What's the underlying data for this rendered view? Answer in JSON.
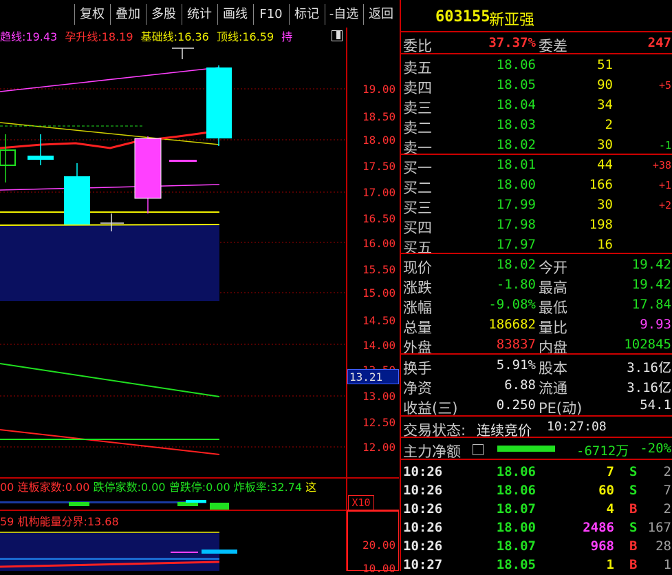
{
  "toolbar": {
    "buttons": [
      "复权",
      "叠加",
      "多股",
      "统计",
      "画线",
      "F10",
      "标记",
      "-自选",
      "返回"
    ]
  },
  "indicator_top": {
    "items": [
      {
        "label": "趋线:",
        "value": "19.43",
        "color": "#ff40ff"
      },
      {
        "label": "孕升线:",
        "value": "18.19",
        "color": "#ff3030"
      },
      {
        "label": "基础线:",
        "value": "16.36",
        "color": "#f0f000"
      },
      {
        "label": "顶线:",
        "value": "16.59",
        "color": "#f0f000"
      },
      {
        "label": "持",
        "value": "",
        "color": "#ff40ff"
      }
    ]
  },
  "price_axis": [
    "19.00",
    "18.50",
    "18.00",
    "17.50",
    "17.00",
    "16.50",
    "16.00",
    "15.50",
    "15.00",
    "14.50",
    "14.00",
    "13.50",
    "13.00",
    "12.50",
    "12.00"
  ],
  "current_marker": "13.21",
  "indicator_mid": {
    "text_parts": [
      {
        "text": "00",
        "color": "#ff3030"
      },
      {
        "text": "连板家数:",
        "color": "#ff3030"
      },
      {
        "text": "0.00",
        "color": "#ff3030"
      },
      {
        "text": "跌停家数:",
        "color": "#20e020"
      },
      {
        "text": "0.00",
        "color": "#20e020"
      },
      {
        "text": "曾跌停:",
        "color": "#20e020"
      },
      {
        "text": "0.00",
        "color": "#20e020"
      },
      {
        "text": "炸板率:",
        "color": "#20e020"
      },
      {
        "text": "32.74",
        "color": "#20e020"
      },
      {
        "text": "这",
        "color": "#f0f000"
      }
    ]
  },
  "x10_label": "X10",
  "indicator_bottom": {
    "prefix": "59",
    "label": "机构能量分界:",
    "value": "13.68"
  },
  "bottom_axis": [
    "20.00",
    "10.00"
  ],
  "stock": {
    "code": "603155",
    "name": "新亚强"
  },
  "weibi": {
    "label": "委比",
    "value": "37.37%",
    "diff_label": "委差",
    "diff_value": "247"
  },
  "sell": [
    {
      "label": "卖五",
      "price": "18.06",
      "vol": "51",
      "chg": ""
    },
    {
      "label": "卖四",
      "price": "18.05",
      "vol": "90",
      "chg": "+5"
    },
    {
      "label": "卖三",
      "price": "18.04",
      "vol": "34",
      "chg": ""
    },
    {
      "label": "卖二",
      "price": "18.03",
      "vol": "2",
      "chg": ""
    },
    {
      "label": "卖一",
      "price": "18.02",
      "vol": "30",
      "chg": "-1"
    }
  ],
  "buy": [
    {
      "label": "买一",
      "price": "18.01",
      "vol": "44",
      "chg": "+38"
    },
    {
      "label": "买二",
      "price": "18.00",
      "vol": "166",
      "chg": "+1"
    },
    {
      "label": "买三",
      "price": "17.99",
      "vol": "30",
      "chg": "+2"
    },
    {
      "label": "买四",
      "price": "17.98",
      "vol": "198",
      "chg": ""
    },
    {
      "label": "买五",
      "price": "17.97",
      "vol": "16",
      "chg": ""
    }
  ],
  "quote": [
    {
      "l1": "现价",
      "v1": "18.02",
      "l2": "今开",
      "v2": "19.42",
      "c1": "#20e020",
      "c2": "#20e020"
    },
    {
      "l1": "涨跌",
      "v1": "-1.80",
      "l2": "最高",
      "v2": "19.42",
      "c1": "#20e020",
      "c2": "#20e020"
    },
    {
      "l1": "涨幅",
      "v1": "-9.08%",
      "l2": "最低",
      "v2": "17.84",
      "c1": "#20e020",
      "c2": "#20e020"
    },
    {
      "l1": "总量",
      "v1": "186682",
      "l2": "量比",
      "v2": "9.93",
      "c1": "#f0f000",
      "c2": "#ff40ff"
    },
    {
      "l1": "外盘",
      "v1": "83837",
      "l2": "内盘",
      "v2": "102845",
      "c1": "#ff3030",
      "c2": "#20e020"
    }
  ],
  "fund": [
    {
      "l1": "换手",
      "v1": "5.91%",
      "l2": "股本",
      "v2": "3.16亿"
    },
    {
      "l1": "净资",
      "v1": "6.88",
      "l2": "流通",
      "v2": "3.16亿"
    },
    {
      "l1": "收益(三)",
      "v1": "0.250",
      "l2": "PE(动)",
      "v2": "54.1"
    }
  ],
  "trade_status": {
    "label": "交易状态:",
    "value": "连续竞价",
    "time": "10:27:08"
  },
  "main_flow": {
    "label": "主力净额",
    "value": "-6712万",
    "pct": "-20%"
  },
  "ticks": [
    {
      "time": "10:26",
      "price": "18.06",
      "vol": "7",
      "side": "S",
      "n": "2",
      "vc": "#f0f000",
      "sc": "#20e020"
    },
    {
      "time": "10:26",
      "price": "18.06",
      "vol": "60",
      "side": "S",
      "n": "7",
      "vc": "#f0f000",
      "sc": "#20e020"
    },
    {
      "time": "10:26",
      "price": "18.07",
      "vol": "4",
      "side": "B",
      "n": "2",
      "vc": "#f0f000",
      "sc": "#ff3030"
    },
    {
      "time": "10:26",
      "price": "18.00",
      "vol": "2486",
      "side": "S",
      "n": "167",
      "vc": "#ff40ff",
      "sc": "#20e020"
    },
    {
      "time": "10:26",
      "price": "18.07",
      "vol": "968",
      "side": "B",
      "n": "28",
      "vc": "#ff40ff",
      "sc": "#ff3030"
    },
    {
      "time": "10:27",
      "price": "18.05",
      "vol": "1",
      "side": "B",
      "n": "1",
      "vc": "#f0f000",
      "sc": "#ff3030"
    }
  ]
}
